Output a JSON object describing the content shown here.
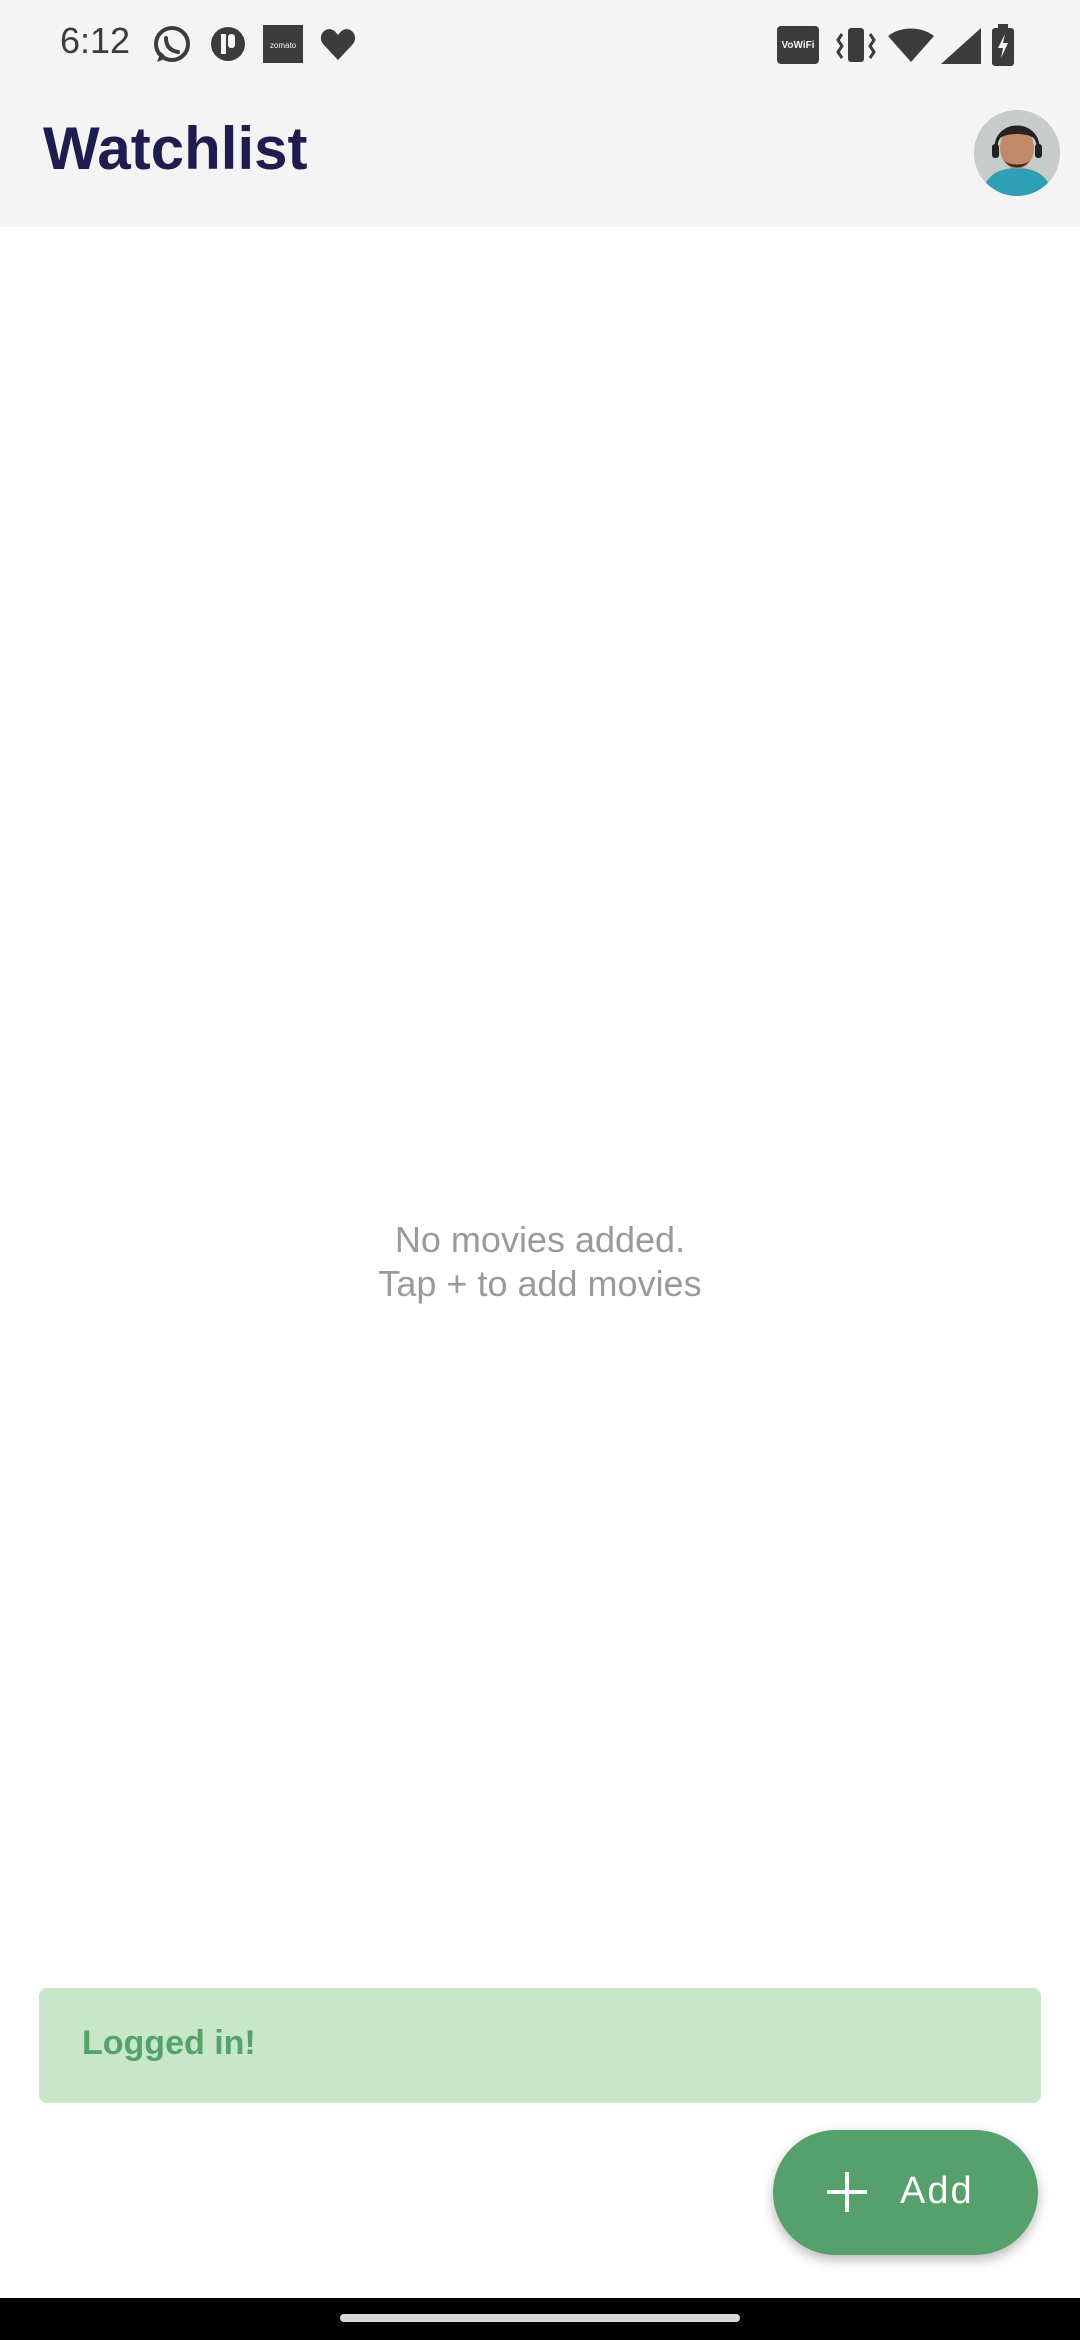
{
  "status_bar": {
    "time": "6:12",
    "left_icons": [
      "whatsapp-icon",
      "notification-app-icon",
      "zomato-icon",
      "heart-icon"
    ],
    "zomato_text": "zomato",
    "vowifi_text": "VoWiFi",
    "right_icons": [
      "vowifi-icon",
      "vibrate-icon",
      "wifi-icon",
      "cell-signal-icon",
      "battery-charging-icon"
    ]
  },
  "app_bar": {
    "title": "Watchlist",
    "avatar": "profile-avatar"
  },
  "empty_state": {
    "line1": "No movies added.",
    "line2": "Tap + to add movies"
  },
  "snackbar": {
    "message": "Logged in!"
  },
  "fab": {
    "label": "Add",
    "icon": "plus-icon"
  },
  "colors": {
    "title": "#1f1c50",
    "fab": "#56a06c",
    "snackbar_bg": "#c7e6ca",
    "snackbar_text": "#55a36b",
    "empty_text": "#9a9a9a"
  }
}
